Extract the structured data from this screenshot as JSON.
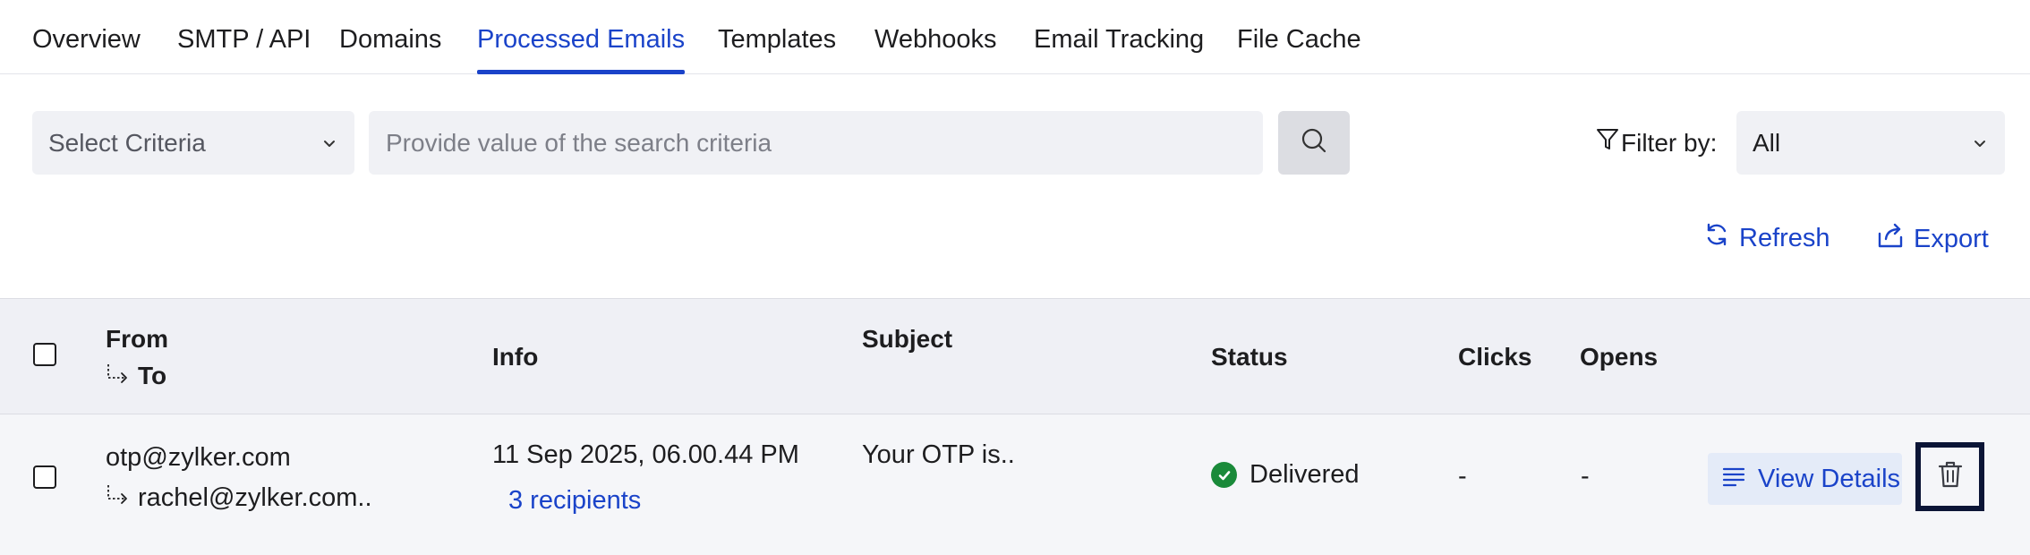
{
  "tabs": [
    {
      "label": "Overview"
    },
    {
      "label": "SMTP / API"
    },
    {
      "label": "Domains"
    },
    {
      "label": "Processed Emails",
      "active": true
    },
    {
      "label": "Templates"
    },
    {
      "label": "Webhooks"
    },
    {
      "label": "Email Tracking"
    },
    {
      "label": "File Cache"
    }
  ],
  "search": {
    "criteria_label": "Select Criteria",
    "placeholder": "Provide value of the search criteria",
    "value": ""
  },
  "filter": {
    "label": "Filter by:",
    "value": "All"
  },
  "actions": {
    "refresh_label": "Refresh",
    "export_label": "Export"
  },
  "table": {
    "headers": {
      "from": "From",
      "to": "To",
      "info": "Info",
      "subject": "Subject",
      "status": "Status",
      "clicks": "Clicks",
      "opens": "Opens"
    },
    "rows": [
      {
        "from": "otp@zylker.com",
        "to": "rachel@zylker.com..",
        "date": "11 Sep 2025, 06.00.44 PM",
        "recipients": "3 recipients",
        "subject": "Your OTP is..",
        "status": "Delivered",
        "clicks": "-",
        "opens": "-",
        "view_details_label": "View Details"
      }
    ]
  },
  "icons": {
    "search": "search-icon",
    "filter": "filter-icon",
    "refresh": "refresh-icon",
    "export": "export-icon",
    "chevron": "chevron-down-icon",
    "status": "check-circle-icon",
    "details": "list-icon",
    "delete": "trash-icon"
  },
  "colors": {
    "accent": "#1a43c9",
    "success": "#1a8a3a",
    "header_bg": "#eff0f5",
    "row_bg": "#f5f6f9",
    "focus_border": "#0b1536"
  }
}
